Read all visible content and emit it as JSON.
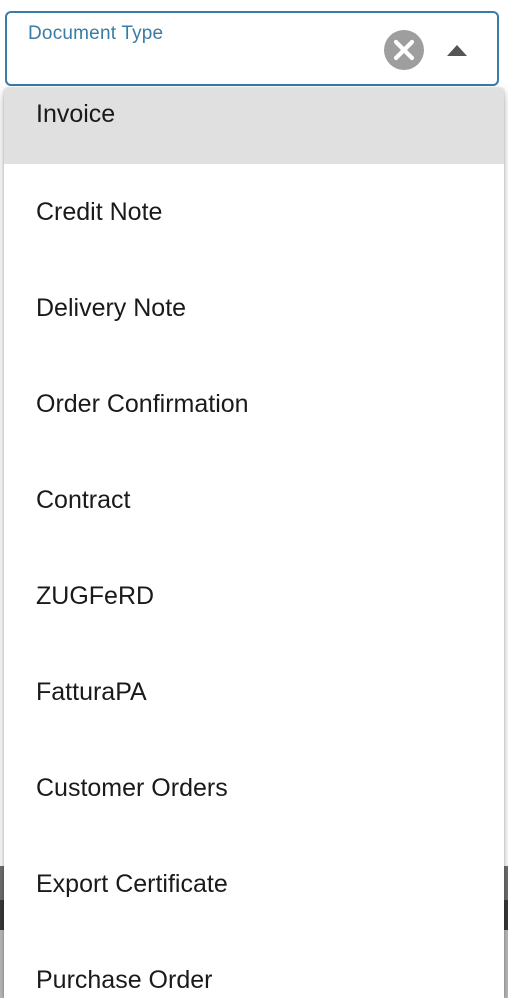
{
  "select": {
    "label": "Document Type",
    "clear_icon": "close-circle-icon",
    "toggle_icon": "caret-up-icon"
  },
  "options": [
    {
      "label": "Invoice",
      "highlighted": true
    },
    {
      "label": "Credit Note"
    },
    {
      "label": "Delivery Note"
    },
    {
      "label": "Order Confirmation"
    },
    {
      "label": "Contract"
    },
    {
      "label": "ZUGFeRD"
    },
    {
      "label": "FatturaPA"
    },
    {
      "label": "Customer Orders"
    },
    {
      "label": "Export Certificate"
    },
    {
      "label": "Purchase Order"
    }
  ],
  "colors": {
    "accent": "#3a7ca5",
    "highlight": "#e0e0e0",
    "clear_button": "#9e9e9e"
  }
}
